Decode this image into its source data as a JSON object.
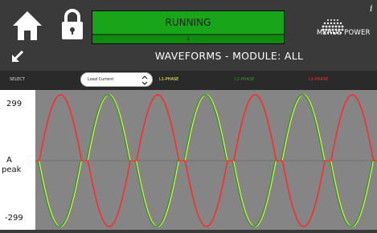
{
  "header": {
    "status_label": "RUNNING",
    "status_sub": "1",
    "brand": "MERUS POWER",
    "info_glyph": "i"
  },
  "subheader": {
    "title": "WAVEFORMS - MODULE: ALL"
  },
  "select": {
    "label": "SELECT",
    "value": "Load Current",
    "legend": [
      {
        "label": "L1-PHASE",
        "color": "#ffff44"
      },
      {
        "label": "L2-PHASE",
        "color": "#2e9e2e"
      },
      {
        "label": "L3-PHASE",
        "color": "#ff2a2a"
      }
    ]
  },
  "plot": {
    "y_top": "299",
    "y_unit_line1": "A",
    "y_unit_line2": "peak",
    "y_bottom": "-299"
  },
  "chart_data": {
    "type": "line",
    "ylim": [
      -299,
      299
    ],
    "ylabel": "A peak",
    "series": [
      {
        "name": "L1-PHASE",
        "color": "#ffff44"
      },
      {
        "name": "L2-PHASE",
        "color": "#2e9e2e"
      },
      {
        "name": "L3-PHASE",
        "color": "#ff2a2a"
      }
    ]
  },
  "icons": {
    "home": "home-icon",
    "lock": "lock-icon",
    "back": "arrow-down-left-icon",
    "chevron": "chevron-up-down-icon",
    "logo": "merus-logo"
  }
}
